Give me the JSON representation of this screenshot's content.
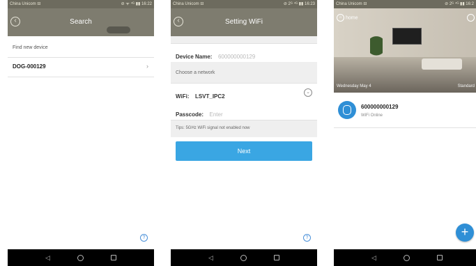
{
  "status_bar": {
    "phone1": {
      "carrier": "China Unicom ⊟",
      "right": "⊘ ᯤ ⁴ᴳ ▮▮ 16:22"
    },
    "phone2": {
      "carrier": "China Unicom ⊟",
      "right": "⊘ 2ᴳ ⁴ᴳ ▮▮ 16:23"
    },
    "phone3": {
      "carrier": "China Unicom ⊟",
      "right": "⊘ 2ᴳ ⁴ᴳ ▮▮ 16:2"
    }
  },
  "phone1": {
    "title": "Search",
    "section_label": "Find new device",
    "device_id": "DOG-000129",
    "chevron": "›",
    "help": "?"
  },
  "phone2": {
    "title": "Setting WiFi",
    "device_name_label": "Device Name:",
    "device_name_value": "600000000129",
    "choose_network_label": "Choose a network",
    "wifi_label": "WiFi:",
    "wifi_value": "LSVT_IPC2",
    "passcode_label": "Passcode:",
    "passcode_placeholder": "Enter",
    "tips": "Tips: 5GHz WiFi signal not enabled now",
    "next_button": "Next",
    "help": "?"
  },
  "phone3": {
    "room_name": "home",
    "date": "Wednesday May 4",
    "mode": "Standard",
    "device_name": "600000000129",
    "device_status": "WiFi Online",
    "add_button": "+"
  },
  "nav": {
    "back": "◁",
    "home": "",
    "recent": ""
  },
  "colors": {
    "accent_blue": "#3aa6e3",
    "title_bar": "#7e7c6f",
    "status_bar": "#6d6b5e"
  }
}
